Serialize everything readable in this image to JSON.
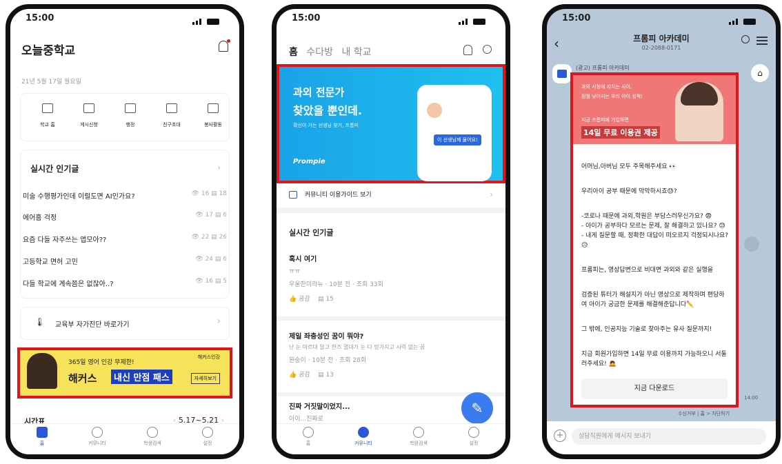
{
  "status": {
    "time": "15:00"
  },
  "phone1": {
    "school_name": "오늘중학교",
    "date": "21년 5월 17일 월요일",
    "quick": [
      "학교 홈",
      "게시신청",
      "행정",
      "친구초대",
      "봉사활동"
    ],
    "popular_title": "실시간 인기글",
    "posts": [
      {
        "title": "미술 수행평가인데 이럴도면 AI인가요?",
        "views": "16",
        "comments": "18"
      },
      {
        "title": "에어홈 걱정",
        "views": "17",
        "comments": "6"
      },
      {
        "title": "요즘 다들 자주쓰는 앱모아??",
        "views": "22",
        "comments": "26"
      },
      {
        "title": "고등학교 면허 고민",
        "views": "24",
        "comments": "6"
      },
      {
        "title": "다들 학교에 계속쯤은 없잖아..?",
        "views": "16",
        "comments": "5"
      }
    ],
    "link_label": "교육부 자가진단 바로가기",
    "ad": {
      "line1": "365일 영어 인강 무제한!",
      "brand": "해커스",
      "highlight": "내신 만점 패스",
      "btn": "자세히보기",
      "tag": "해커스인강"
    },
    "timetable_title": "시간표",
    "timetable_range": "5.17~5.21",
    "nav": [
      "홈",
      "커뮤니티",
      "학생검색",
      "설정"
    ]
  },
  "phone2": {
    "tabs": [
      "홈",
      "수다방",
      "내 학교"
    ],
    "banner": {
      "line1": "과외 전문가",
      "line2": "찾았을 뿐인데.",
      "sub": "확신이 가는 선생님 찾기, 프롬피",
      "brand": "Prompie",
      "card_btn": "이 선생님께 물어요!"
    },
    "guide": "커뮤니티 이용가이드 보기",
    "popular_title": "실시간 인기글",
    "posts": [
      {
        "title": "혹시 여기",
        "body": "ㅠㅠ",
        "meta": "우울한미라뉴 · 10분 전 · 조회 33회",
        "likes": "공감",
        "comments": "15"
      },
      {
        "title": "제일 좌충성인 꿈이 뭐야?",
        "body": "난 눈 마르대 말고 한즈 멸대가 눈 다 망가지고 시력 없는 꿈",
        "meta": "원숭이 · 10분 전 · 조회 28회",
        "likes": "공감",
        "comments": "13"
      },
      {
        "title": "진짜 거짓말이었지...",
        "body": "아이...진짜로",
        "meta": "",
        "likes": "",
        "comments": ""
      }
    ],
    "nav": [
      "홈",
      "커뮤니티",
      "학원검색",
      "설정"
    ]
  },
  "phone3": {
    "title": "프롬피 아카데미",
    "phone": "02-2088-0171",
    "sender": "(광고) 프롬피 아카데미",
    "img": {
      "line1": "과외 서칭에 지치는 사이,",
      "line2": "점점 낮아지는 우리 아이 성적!",
      "line3": "지금 프롬피에 가입하면",
      "promo": "14일 무료 이용권 제공"
    },
    "paragraphs": [
      "어머님,아버님 모두 주목해주세요 👀",
      "우리아이 공부 때문에 막막하시죠😓?",
      "-코로나 때문에 과외,학원은 부담스러우신가요? 😨\n- 아이가 공부하다 모르는 문제, 잘 해결하고 있나요? 😓\n- 내게 질문할 때, 정확한 대답이 떠오르지 걱정되시나요? 😥",
      "프롬피는, 영상답변으로 비대면 과외와 같은 실행을",
      "검증된 튜터가 해설지가 아닌 영상으로 제작하며 편당하여 아이가 궁금한 문제를 해결해준답니다✏️",
      "그 밖에, 인공지능 기술로 찾아주는 유사 질문까지!",
      "지금 회원가입하면 14일 무료 이용까지 가능하오니 서둘러주세요! 🙇"
    ],
    "download": "지금 다운로드",
    "time": "14:00",
    "footer_note": "수신거부 | 홈 > 차단하기",
    "input_placeholder": "상담직원에게 메시지 보내기"
  }
}
